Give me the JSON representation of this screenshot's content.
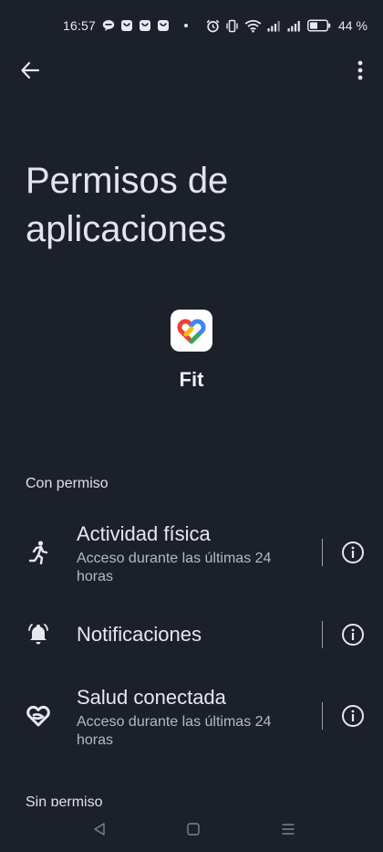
{
  "status_bar": {
    "time": "16:57",
    "battery_percent": "44 %",
    "notification_icons": [
      "chat-bubble-icon",
      "shopping-bag-icon",
      "shopping-bag-icon",
      "shopping-bag-icon"
    ],
    "system_icons": [
      "alarm-icon",
      "vibrate-icon",
      "wifi-icon",
      "signal-icon",
      "signal-icon",
      "battery-icon"
    ]
  },
  "app_bar": {
    "back_icon": "arrow-back-icon",
    "more_icon": "more-vert-icon"
  },
  "page": {
    "title": "Permisos de aplicaciones"
  },
  "app": {
    "name": "Fit",
    "icon": "google-fit-heart-icon"
  },
  "sections": {
    "allowed": {
      "header": "Con permiso",
      "items": [
        {
          "title": "Actividad física",
          "subtitle": "Acceso durante las últimas 24 horas",
          "icon": "running-person-icon"
        },
        {
          "title": "Notificaciones",
          "subtitle": "",
          "icon": "bell-icon"
        },
        {
          "title": "Salud conectada",
          "subtitle": "Acceso durante las últimas 24 horas",
          "icon": "health-connect-icon"
        }
      ]
    },
    "denied": {
      "header": "Sin permiso"
    }
  },
  "nav_bar": {
    "buttons": [
      "nav-back-icon",
      "nav-home-icon",
      "nav-menu-icon"
    ]
  },
  "colors": {
    "background": "#1c202b",
    "text_primary": "#e3e5ec",
    "text_secondary": "#b5b9c4"
  }
}
